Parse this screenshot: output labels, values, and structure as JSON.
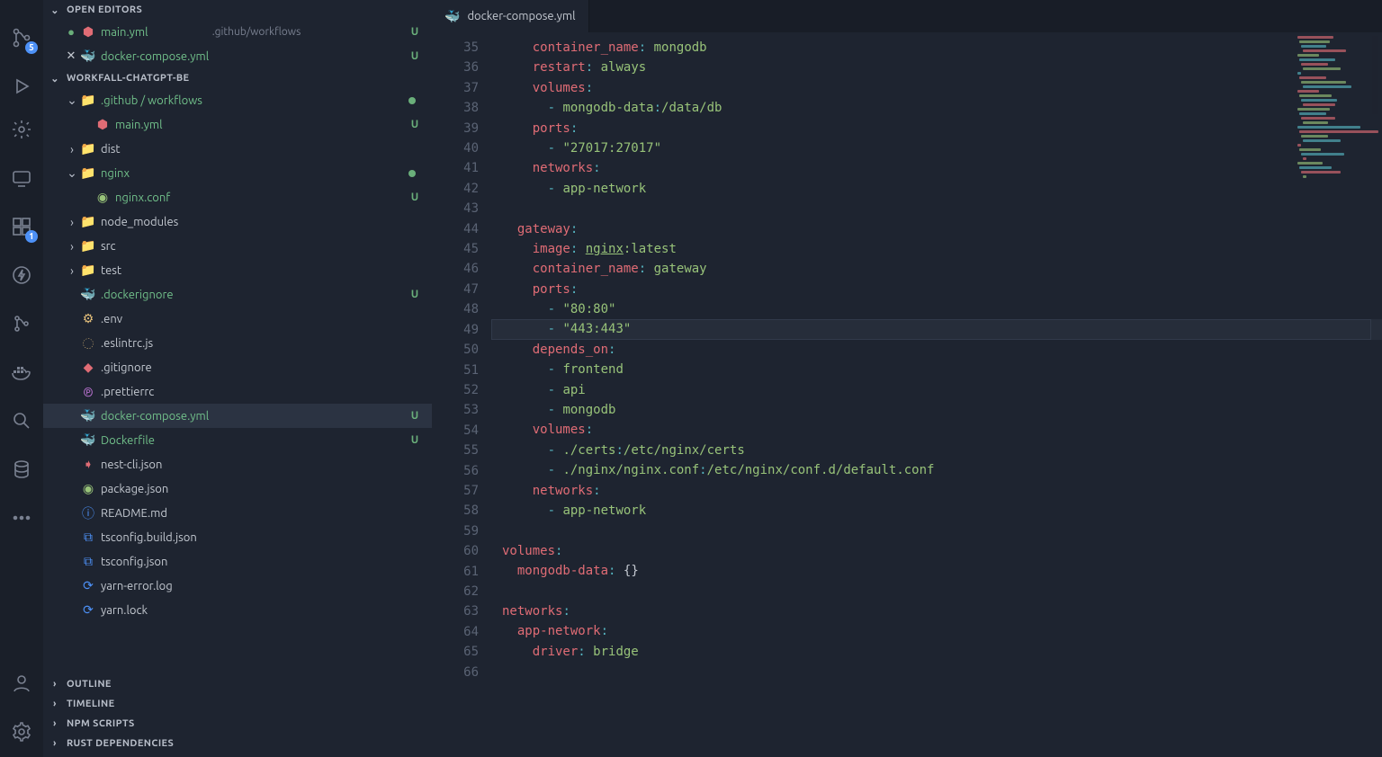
{
  "activity": {
    "badge_scm": "5",
    "badge_ext": "1"
  },
  "sections": {
    "open_editors": "OPEN EDITORS",
    "workspace": "WORKFALL-CHATGPT-BE",
    "outline": "OUTLINE",
    "timeline": "TIMELINE",
    "npm": "NPM SCRIPTS",
    "rust": "RUST DEPENDENCIES"
  },
  "open_editors": [
    {
      "icon": "●",
      "iconCls": "st-U",
      "fileIcon": "⬢",
      "fileIconCls": "ic-yaml-red",
      "label": "main.yml",
      "label_green": true,
      "sublabel": ".github/workflows",
      "status": "U"
    },
    {
      "icon": "✕",
      "iconCls": "ic-close",
      "fileIcon": "🐳",
      "fileIconCls": "ic-docker",
      "label": "docker-compose.yml",
      "label_green": true,
      "sublabel": "",
      "status": "U"
    }
  ],
  "tree": [
    {
      "depth": 1,
      "chev": "v",
      "icon": "📁",
      "iconCls": "ic-folder",
      "label": ".github / workflows",
      "label_green": true,
      "dot": true
    },
    {
      "depth": 2,
      "chev": "",
      "icon": "⬢",
      "iconCls": "ic-yaml-red",
      "label": "main.yml",
      "label_green": true,
      "status": "U"
    },
    {
      "depth": 1,
      "chev": ">",
      "icon": "📁",
      "iconCls": "ic-red-folder",
      "label": "dist"
    },
    {
      "depth": 1,
      "chev": "v",
      "icon": "📁",
      "iconCls": "ic-folder",
      "label": "nginx",
      "label_green": true,
      "dot": true
    },
    {
      "depth": 2,
      "chev": "",
      "icon": "◉",
      "iconCls": "ic-nginx",
      "label": "nginx.conf",
      "label_green": true,
      "status": "U"
    },
    {
      "depth": 1,
      "chev": ">",
      "icon": "📁",
      "iconCls": "ic-green-folder",
      "label": "node_modules"
    },
    {
      "depth": 1,
      "chev": ">",
      "icon": "📁",
      "iconCls": "ic-green-folder",
      "label": "src"
    },
    {
      "depth": 1,
      "chev": ">",
      "icon": "📁",
      "iconCls": "ic-teal-folder",
      "label": "test"
    },
    {
      "depth": 1,
      "chev": "",
      "icon": "🐳",
      "iconCls": "ic-docker",
      "label": ".dockerignore",
      "label_green": true,
      "status": "U"
    },
    {
      "depth": 1,
      "chev": "",
      "icon": "⚙",
      "iconCls": "ic-env",
      "label": ".env"
    },
    {
      "depth": 1,
      "chev": "",
      "icon": "◌",
      "iconCls": "ic-js",
      "label": ".eslintrc.js"
    },
    {
      "depth": 1,
      "chev": "",
      "icon": "◆",
      "iconCls": "ic-git",
      "label": ".gitignore"
    },
    {
      "depth": 1,
      "chev": "",
      "icon": "℗",
      "iconCls": "ic-prettier",
      "label": ".prettierrc"
    },
    {
      "depth": 1,
      "chev": "",
      "icon": "🐳",
      "iconCls": "ic-docker",
      "label": "docker-compose.yml",
      "label_green": true,
      "status": "U",
      "selected": true
    },
    {
      "depth": 1,
      "chev": "",
      "icon": "🐳",
      "iconCls": "ic-docker",
      "label": "Dockerfile",
      "label_green": true,
      "status": "U"
    },
    {
      "depth": 1,
      "chev": "",
      "icon": "➧",
      "iconCls": "ic-nest",
      "label": "nest-cli.json"
    },
    {
      "depth": 1,
      "chev": "",
      "icon": "◉",
      "iconCls": "ic-json",
      "label": "package.json"
    },
    {
      "depth": 1,
      "chev": "",
      "icon": "ⓘ",
      "iconCls": "ic-info",
      "label": "README.md"
    },
    {
      "depth": 1,
      "chev": "",
      "icon": "⧉",
      "iconCls": "ic-ts",
      "label": "tsconfig.build.json"
    },
    {
      "depth": 1,
      "chev": "",
      "icon": "⧉",
      "iconCls": "ic-ts",
      "label": "tsconfig.json"
    },
    {
      "depth": 1,
      "chev": "",
      "icon": "⟳",
      "iconCls": "ic-yarnblue",
      "label": "yarn-error.log"
    },
    {
      "depth": 1,
      "chev": "",
      "icon": "⟳",
      "iconCls": "ic-yarnblue",
      "label": "yarn.lock"
    }
  ],
  "tab": {
    "icon": "🐳",
    "label": "docker-compose.yml"
  },
  "code": {
    "start": 35,
    "highlight": 49,
    "lines": [
      [
        [
          "    ",
          ""
        ],
        [
          "container_name",
          "key"
        ],
        [
          ":",
          "col"
        ],
        [
          " mongodb",
          "str"
        ]
      ],
      [
        [
          "    ",
          ""
        ],
        [
          "restart",
          "key"
        ],
        [
          ":",
          "col"
        ],
        [
          " always",
          "str"
        ]
      ],
      [
        [
          "    ",
          ""
        ],
        [
          "volumes",
          "key"
        ],
        [
          ":",
          "col"
        ]
      ],
      [
        [
          "      ",
          ""
        ],
        [
          "-",
          "dash"
        ],
        [
          " mongodb-data",
          "str"
        ],
        [
          ":",
          "col"
        ],
        [
          "/data/db",
          "str"
        ]
      ],
      [
        [
          "    ",
          ""
        ],
        [
          "ports",
          "key"
        ],
        [
          ":",
          "col"
        ]
      ],
      [
        [
          "      ",
          ""
        ],
        [
          "-",
          "dash"
        ],
        [
          " \"27017:27017\"",
          "str"
        ]
      ],
      [
        [
          "    ",
          ""
        ],
        [
          "networks",
          "key"
        ],
        [
          ":",
          "col"
        ]
      ],
      [
        [
          "      ",
          ""
        ],
        [
          "-",
          "dash"
        ],
        [
          " app-network",
          "str"
        ]
      ],
      [
        [
          "",
          ""
        ]
      ],
      [
        [
          "  ",
          ""
        ],
        [
          "gateway",
          "key"
        ],
        [
          ":",
          "col"
        ]
      ],
      [
        [
          "    ",
          ""
        ],
        [
          "image",
          "key"
        ],
        [
          ":",
          "col"
        ],
        [
          " ",
          "plain"
        ],
        [
          "nginx",
          "link"
        ],
        [
          ":latest",
          "str"
        ]
      ],
      [
        [
          "    ",
          ""
        ],
        [
          "container_name",
          "key"
        ],
        [
          ":",
          "col"
        ],
        [
          " gateway",
          "str"
        ]
      ],
      [
        [
          "    ",
          ""
        ],
        [
          "ports",
          "key"
        ],
        [
          ":",
          "col"
        ]
      ],
      [
        [
          "      ",
          ""
        ],
        [
          "-",
          "dash"
        ],
        [
          " \"80:80\"",
          "str"
        ]
      ],
      [
        [
          "      ",
          ""
        ],
        [
          "-",
          "dash"
        ],
        [
          " \"443:443\"",
          "str"
        ]
      ],
      [
        [
          "    ",
          ""
        ],
        [
          "depends_on",
          "key"
        ],
        [
          ":",
          "col"
        ]
      ],
      [
        [
          "      ",
          ""
        ],
        [
          "-",
          "dash"
        ],
        [
          " frontend",
          "str"
        ]
      ],
      [
        [
          "      ",
          ""
        ],
        [
          "-",
          "dash"
        ],
        [
          " api",
          "str"
        ]
      ],
      [
        [
          "      ",
          ""
        ],
        [
          "-",
          "dash"
        ],
        [
          " mongodb",
          "str"
        ]
      ],
      [
        [
          "    ",
          ""
        ],
        [
          "volumes",
          "key"
        ],
        [
          ":",
          "col"
        ]
      ],
      [
        [
          "      ",
          ""
        ],
        [
          "-",
          "dash"
        ],
        [
          " ./certs",
          "str"
        ],
        [
          ":",
          "col"
        ],
        [
          "/etc/nginx/certs",
          "str"
        ]
      ],
      [
        [
          "      ",
          ""
        ],
        [
          "-",
          "dash"
        ],
        [
          " ./nginx/nginx.conf",
          "str"
        ],
        [
          ":",
          "col"
        ],
        [
          "/etc/nginx/conf.d/default.conf",
          "str"
        ]
      ],
      [
        [
          "    ",
          ""
        ],
        [
          "networks",
          "key"
        ],
        [
          ":",
          "col"
        ]
      ],
      [
        [
          "      ",
          ""
        ],
        [
          "-",
          "dash"
        ],
        [
          " app-network",
          "str"
        ]
      ],
      [
        [
          "",
          ""
        ]
      ],
      [
        [
          "volumes",
          "key"
        ],
        [
          ":",
          "col"
        ]
      ],
      [
        [
          "  ",
          ""
        ],
        [
          "mongodb-data",
          "key"
        ],
        [
          ":",
          "col"
        ],
        [
          " ",
          "plain"
        ],
        [
          "{}",
          "brace"
        ]
      ],
      [
        [
          "",
          ""
        ]
      ],
      [
        [
          "networks",
          "key"
        ],
        [
          ":",
          "col"
        ]
      ],
      [
        [
          "  ",
          ""
        ],
        [
          "app-network",
          "key"
        ],
        [
          ":",
          "col"
        ]
      ],
      [
        [
          "    ",
          ""
        ],
        [
          "driver",
          "key"
        ],
        [
          ":",
          "col"
        ],
        [
          " bridge",
          "str"
        ]
      ],
      [
        [
          "",
          ""
        ]
      ]
    ]
  },
  "minimap_widths": [
    40,
    34,
    28,
    48,
    24,
    40,
    30,
    42,
    4,
    30,
    50,
    54,
    24,
    36,
    40,
    36,
    36,
    30,
    38,
    28,
    70,
    88,
    30,
    42,
    4,
    24,
    48,
    4,
    28,
    36,
    44,
    4
  ]
}
